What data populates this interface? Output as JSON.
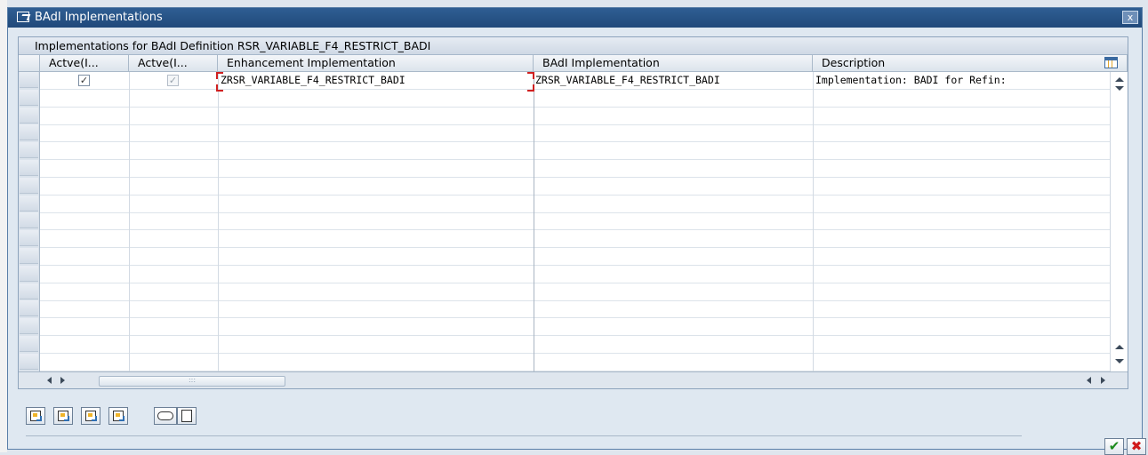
{
  "window": {
    "title": "BAdI Implementations",
    "close_label": "x"
  },
  "grid": {
    "title": "Implementations for BAdI Definition RSR_VARIABLE_F4_RESTRICT_BADI",
    "columns": [
      "Actve(I...",
      "Actve(I...",
      "Enhancement Implementation",
      "BAdI Implementation",
      "Description"
    ],
    "rows": [
      {
        "active1": true,
        "active2": true,
        "enhancement": "ZRSR_VARIABLE_F4_RESTRICT_BADI",
        "badi": "ZRSR_VARIABLE_F4_RESTRICT_BADI",
        "description": "Implementation: BADI for Refin:"
      }
    ],
    "empty_rows": 15,
    "checkmark": "✓"
  },
  "toolbar": {
    "buttons": [
      "create-implementation",
      "change-implementation",
      "display-implementation",
      "delete-implementation",
      "activate-implementation",
      "new-entry"
    ]
  },
  "dialog_buttons": {
    "ok": "✔",
    "cancel": "✖"
  },
  "colors": {
    "titlebar": "#2f5e93",
    "selection_marker": "#d02020"
  }
}
